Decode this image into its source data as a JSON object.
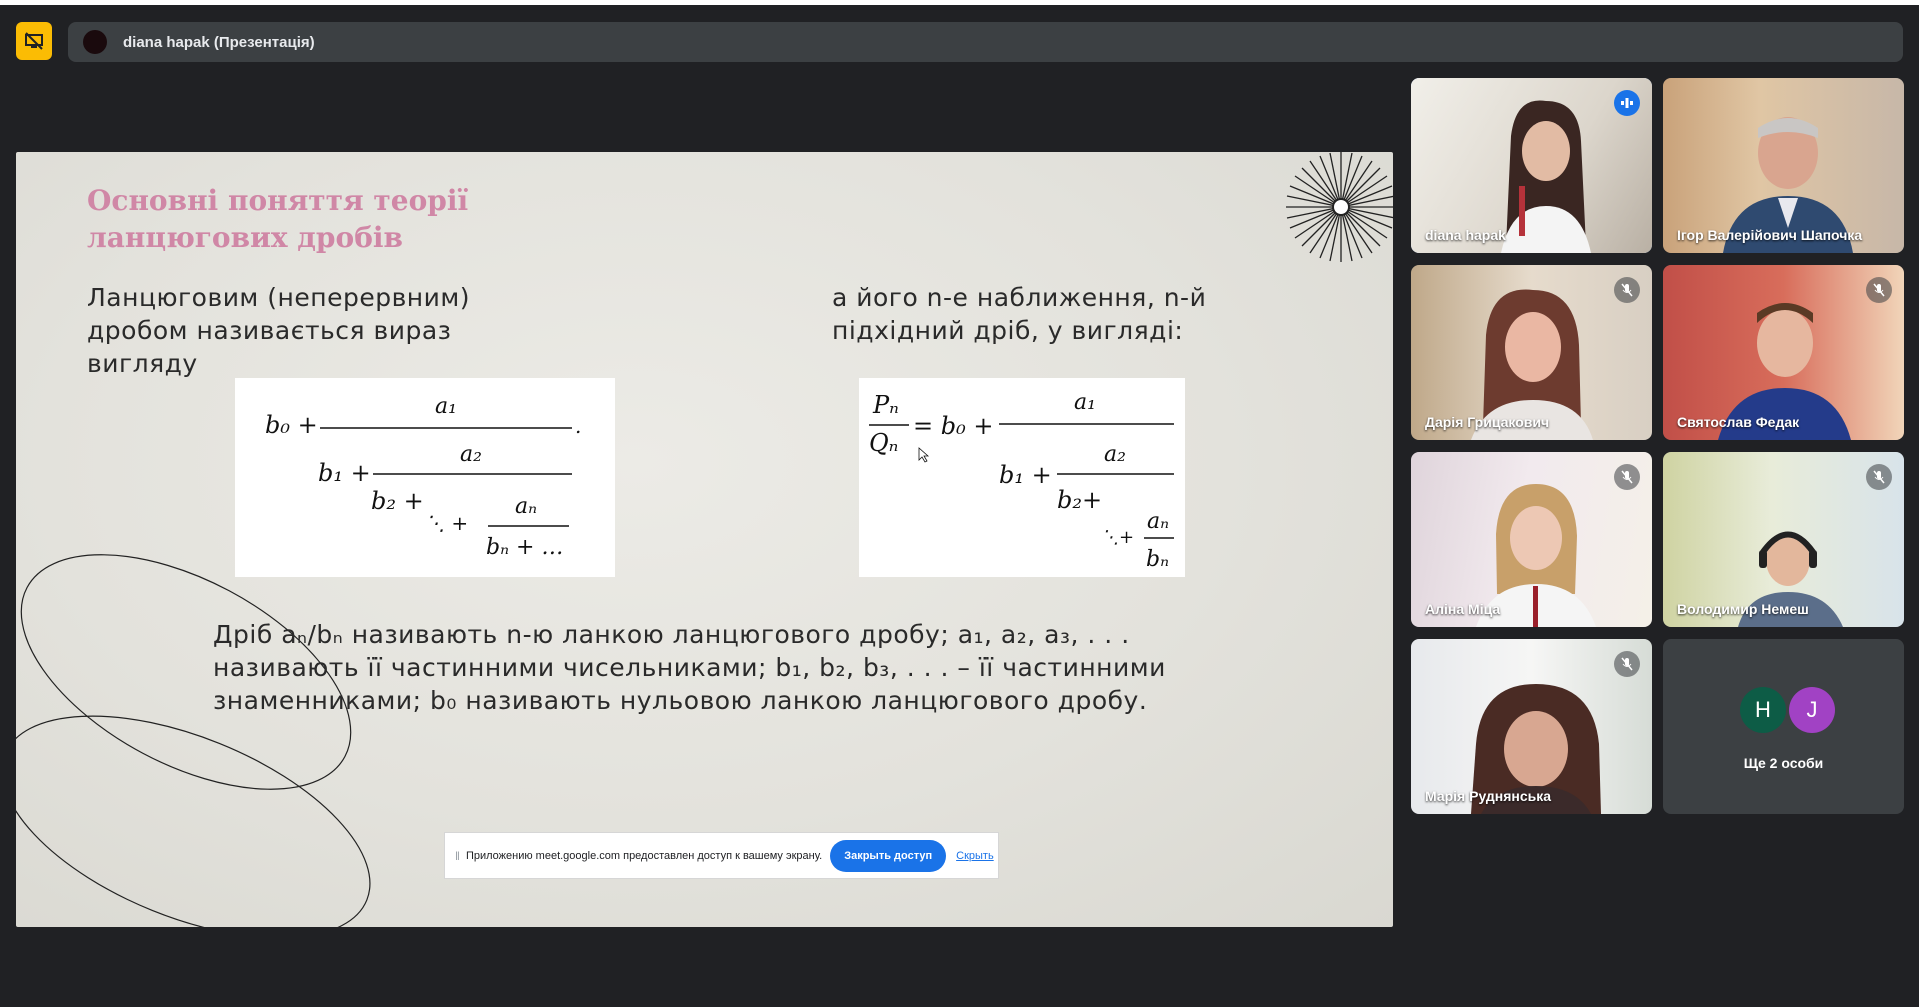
{
  "header": {
    "presenter_title": "diana hapak (Презентація)",
    "present_icon": "screen-share-off-icon"
  },
  "slide": {
    "title_line1": "Основні поняття теорії",
    "title_line2": "ланцюгових дробів",
    "left_text": "Ланцюговим (неперервним) дробом називається вираз вигляду",
    "right_text": "а його n-е наближення, n-й підхідний дріб, у вигляді:",
    "bottom_text": "Дріб aₙ/bₙ називають n-ю ланкою ланцюгового дробу; a₁, a₂, a₃, . . . називають її частинними чисельниками; b₁, b₂, b₃, . . . – її частинними знаменниками; b₀ називають нульовою ланкою ланцюгового дробу.",
    "title_color": "#d087a6"
  },
  "share_banner": {
    "message": "Приложению meet.google.com предоставлен доступ к вашему экрану.",
    "stop_label": "Закрыть доступ",
    "hide_label": "Скрыть"
  },
  "participants": [
    {
      "name": "diana hapak",
      "status": "speaking"
    },
    {
      "name": "Ігор Валерійович Шапочка",
      "status": "none"
    },
    {
      "name": "Дарія Грицакович",
      "status": "muted"
    },
    {
      "name": "Святослав Федак",
      "status": "muted"
    },
    {
      "name": "Аліна Міца",
      "status": "muted"
    },
    {
      "name": "Володимир Немеш",
      "status": "muted"
    },
    {
      "name": "Марія Руднянська",
      "status": "muted"
    }
  ],
  "more_tile": {
    "avatar1": "H",
    "avatar2": "J",
    "label": "Ще 2 особи"
  },
  "colors": {
    "background": "#202124",
    "tile": "#3c4043",
    "accent_blue": "#1a73e8",
    "present_yellow": "#fbbc04"
  }
}
